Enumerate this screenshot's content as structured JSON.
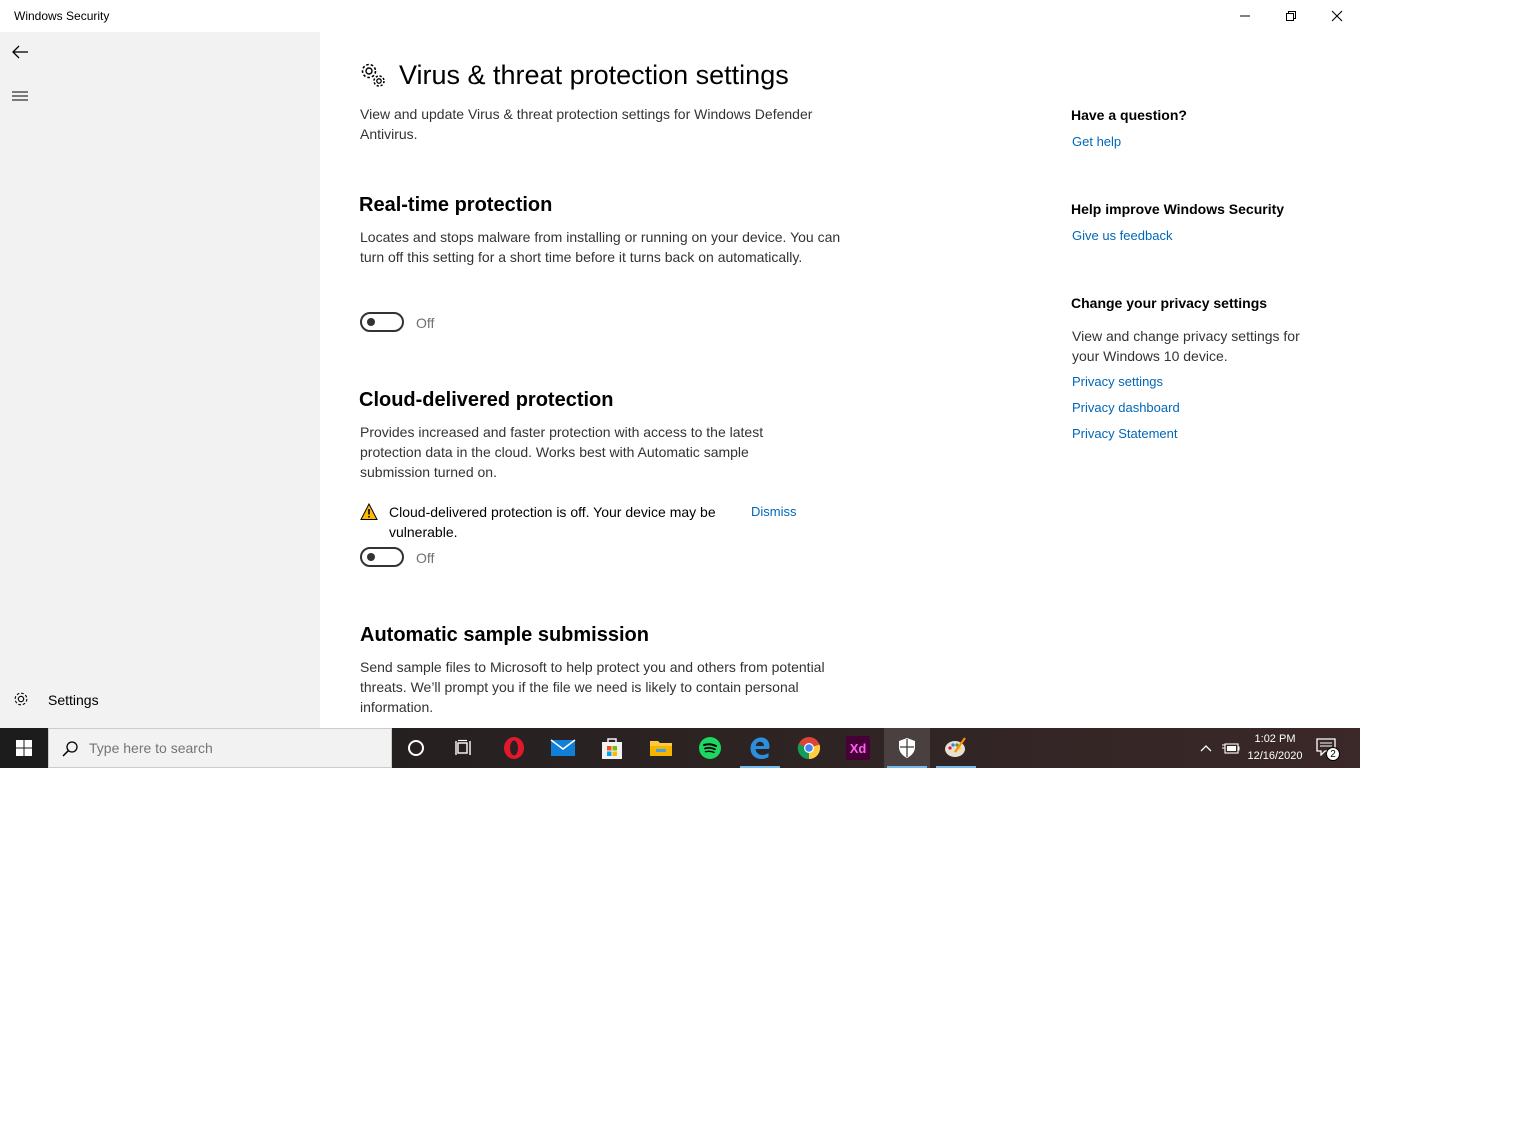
{
  "window": {
    "title": "Windows Security"
  },
  "sidebar": {
    "settings_label": "Settings"
  },
  "page": {
    "title": "Virus & threat protection settings",
    "description": "View and update Virus & threat protection settings for Windows Defender Antivirus."
  },
  "sections": {
    "realtime": {
      "heading": "Real-time protection",
      "description": "Locates and stops malware from installing or running on your device. You can turn off this setting for a short time before it turns back on automatically.",
      "toggle_state": "Off"
    },
    "cloud": {
      "heading": "Cloud-delivered protection",
      "description": "Provides increased and faster protection with access to the latest protection data in the cloud. Works best with Automatic sample submission turned on.",
      "warning": "Cloud-delivered protection is off. Your device may be vulnerable.",
      "dismiss_label": "Dismiss",
      "toggle_state": "Off"
    },
    "sample": {
      "heading": "Automatic sample submission",
      "description": "Send sample files to Microsoft to help protect you and others from potential threats. We’ll prompt you if the file we need is likely to contain personal information."
    }
  },
  "aside": {
    "question_heading": "Have a question?",
    "get_help": "Get help",
    "improve_heading": "Help improve Windows Security",
    "feedback": "Give us feedback",
    "privacy_heading": "Change your privacy settings",
    "privacy_text": "View and change privacy settings for your Windows 10 device.",
    "privacy_settings": "Privacy settings",
    "privacy_dashboard": "Privacy dashboard",
    "privacy_statement": "Privacy Statement"
  },
  "taskbar": {
    "search_placeholder": "Type here to search",
    "time": "1:02 PM",
    "date": "12/16/2020",
    "notification_count": "2",
    "apps": [
      "cortana-icon",
      "task-view-icon",
      "opera-icon",
      "mail-icon",
      "store-icon",
      "file-explorer-icon",
      "spotify-icon",
      "edge-icon",
      "chrome-icon",
      "adobe-xd-icon",
      "windows-security-icon",
      "paint-icon"
    ],
    "xd_label": "Xd"
  },
  "colors": {
    "accent": "#0067b8",
    "warning": "#ffb900",
    "sidebar_bg": "#f2f2f2"
  }
}
